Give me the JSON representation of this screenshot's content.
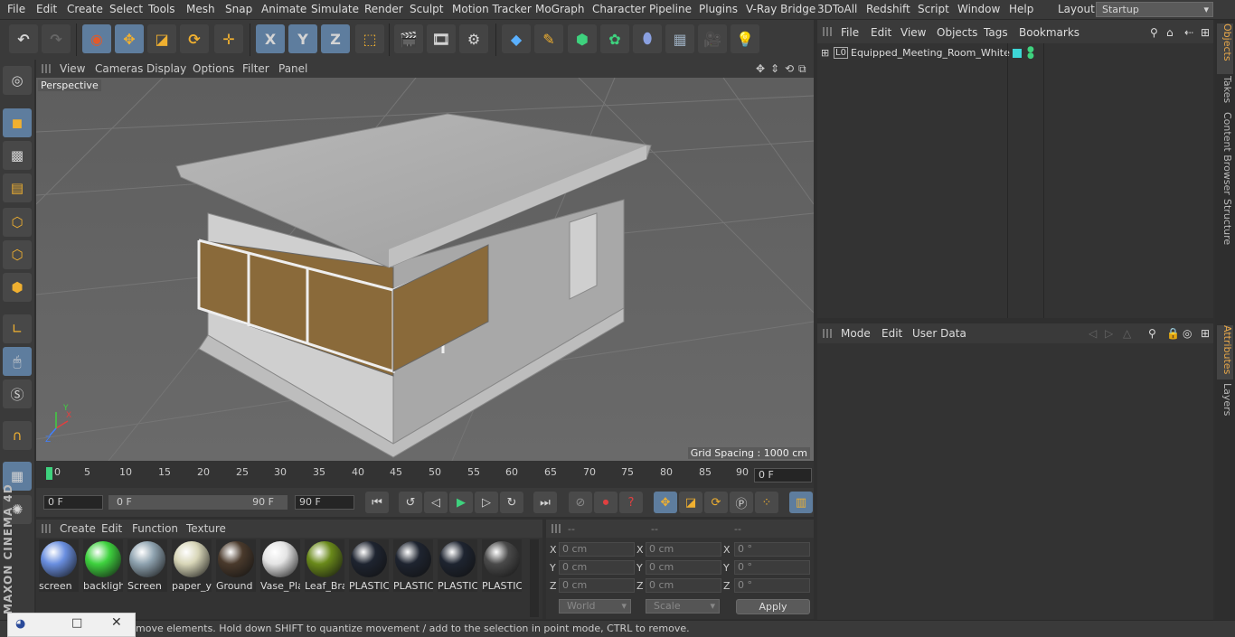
{
  "menubar": {
    "items": [
      "File",
      "Edit",
      "Create",
      "Select",
      "Tools",
      "Mesh",
      "Snap",
      "Animate",
      "Simulate",
      "Render",
      "Sculpt",
      "Motion Tracker",
      "MoGraph",
      "Character",
      "Pipeline",
      "Plugins",
      "V-Ray Bridge",
      "3DToAll",
      "Redshift",
      "Script",
      "Window",
      "Help"
    ],
    "layout_label": "Layout:",
    "layout_value": "Startup"
  },
  "toolbar": {
    "axis_x": "X",
    "axis_y": "Y",
    "axis_z": "Z"
  },
  "left_toolbar": {
    "brand": "MAXON CINEMA 4D"
  },
  "viewport": {
    "menu": [
      "View",
      "Cameras",
      "Display",
      "Options",
      "Filter",
      "Panel"
    ],
    "label": "Perspective",
    "grid_spacing": "Grid Spacing : 1000 cm"
  },
  "timeline": {
    "ticks": [
      "0",
      "5",
      "10",
      "15",
      "20",
      "25",
      "30",
      "35",
      "40",
      "45",
      "50",
      "55",
      "60",
      "65",
      "70",
      "75",
      "80",
      "85",
      "90"
    ],
    "current_frame": "0 F"
  },
  "playbar": {
    "start_field": "0 F",
    "range_start": "0 F",
    "range_end": "90 F",
    "end_field": "90 F"
  },
  "materials": {
    "menu": [
      "Create",
      "Edit",
      "Function",
      "Texture"
    ],
    "items": [
      {
        "label": "screen",
        "color": "#6a8fe0"
      },
      {
        "label": "backligh",
        "color": "#3ed23e"
      },
      {
        "label": "Screen",
        "color": "#8fa3b0"
      },
      {
        "label": "paper_y",
        "color": "#d8d6b8"
      },
      {
        "label": "Ground",
        "color": "#4a3a2c"
      },
      {
        "label": "Vase_Pla",
        "color": "#e4e4e4"
      },
      {
        "label": "Leaf_Bra",
        "color": "#6a8a1a"
      },
      {
        "label": "PLASTIC",
        "color": "#1e2430"
      },
      {
        "label": "PLASTIC",
        "color": "#1e2430"
      },
      {
        "label": "PLASTIC",
        "color": "#1e2430"
      },
      {
        "label": "PLASTIC",
        "color": "#4a4a4a"
      }
    ]
  },
  "coordinates": {
    "headers": [
      "--",
      "--",
      "--"
    ],
    "rows": [
      {
        "axis": "X",
        "pos": "0 cm",
        "size_axis": "X",
        "size": "0 cm",
        "rot_axis": "X",
        "rot": "0 °"
      },
      {
        "axis": "Y",
        "pos": "0 cm",
        "size_axis": "Y",
        "size": "0 cm",
        "rot_axis": "Y",
        "rot": "0 °"
      },
      {
        "axis": "Z",
        "pos": "0 cm",
        "size_axis": "Z",
        "size": "0 cm",
        "rot_axis": "Z",
        "rot": "0 °"
      }
    ],
    "world_label": "World",
    "scale_label": "Scale",
    "apply_label": "Apply"
  },
  "objects_panel": {
    "menu": [
      "File",
      "Edit",
      "View",
      "Objects",
      "Tags",
      "Bookmarks"
    ],
    "object_name": "Equipped_Meeting_Room_White",
    "layer_icon": "L0"
  },
  "attributes_panel": {
    "menu": [
      "Mode",
      "Edit",
      "User Data"
    ]
  },
  "right_tabs": [
    "Objects",
    "Takes",
    "Content Browser",
    "Structure",
    "Attributes",
    "Layers"
  ],
  "status_text": "move elements. Hold down SHIFT to quantize movement / add to the selection in point mode, CTRL to remove.",
  "colors": {
    "accent_blue": "#5e7d9e",
    "active_tab": "#e8a84a",
    "object_tag": "#3dd6d6"
  }
}
